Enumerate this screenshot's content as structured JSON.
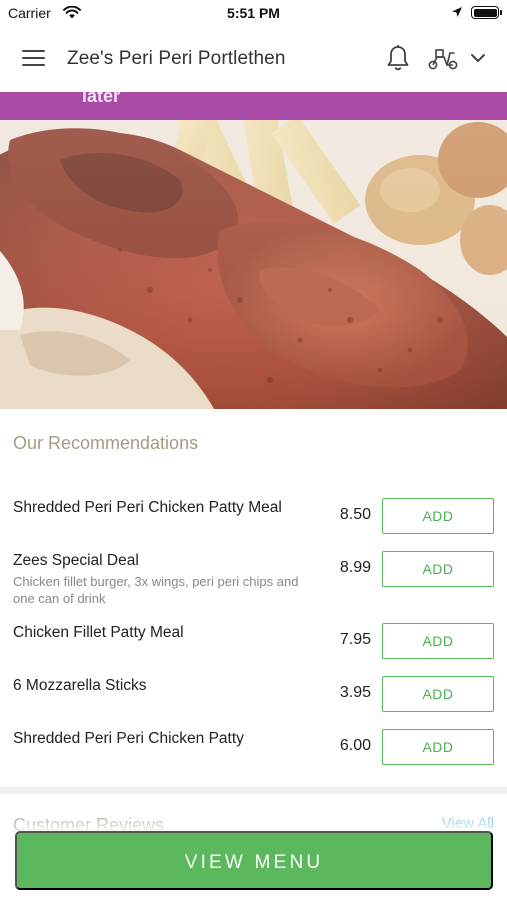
{
  "status_bar": {
    "carrier": "Carrier",
    "time": "5:51 PM"
  },
  "header": {
    "title": "Zee's Peri Peri Portlethen",
    "icons": [
      "menu-icon",
      "bell-icon",
      "scooter-icon",
      "chevron-down-icon"
    ]
  },
  "promo_banner": {
    "text": "later",
    "color": "#a94aa6"
  },
  "recommendations": {
    "title": "Our Recommendations",
    "items": [
      {
        "name": "Shredded Peri Peri Chicken Patty Meal",
        "description": "",
        "price": "8.50",
        "button": "ADD"
      },
      {
        "name": "Zees Special Deal",
        "description": "Chicken fillet burger, 3x wings, peri peri chips and one can of drink",
        "price": "8.99",
        "button": "ADD"
      },
      {
        "name": "Chicken Fillet Patty Meal",
        "description": "",
        "price": "7.95",
        "button": "ADD"
      },
      {
        "name": "6 Mozzarella Sticks",
        "description": "",
        "price": "3.95",
        "button": "ADD"
      },
      {
        "name": "Shredded Peri Peri Chicken Patty",
        "description": "",
        "price": "6.00",
        "button": "ADD"
      }
    ]
  },
  "reviews": {
    "title": "Customer Reviews",
    "link": "View All"
  },
  "footer": {
    "view_menu_label": "VIEW MENU"
  },
  "colors": {
    "accent_green": "#5cb85c",
    "heading_tan": "#a89a86",
    "banner_purple": "#a94aa6"
  }
}
